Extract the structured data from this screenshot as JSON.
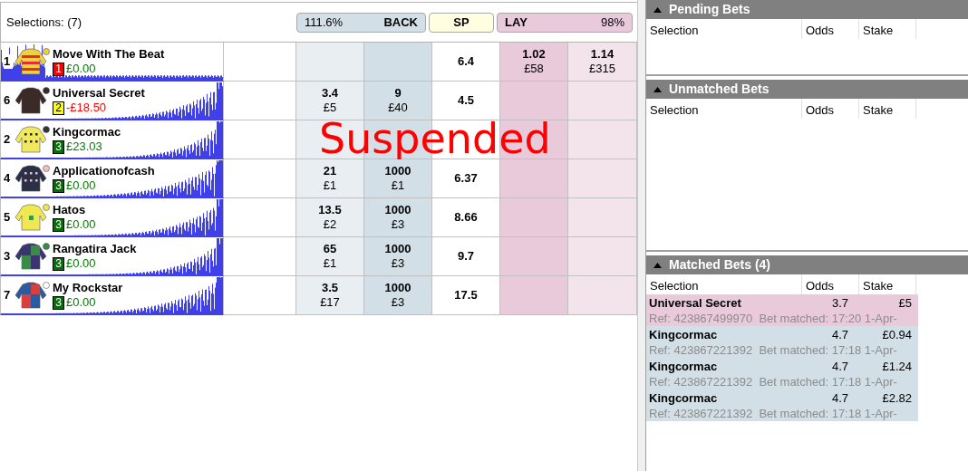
{
  "market": {
    "selections_label": "Selections: (7)",
    "back_header": {
      "percent": "111.6%",
      "label": "BACK"
    },
    "sp_header": {
      "label": "SP"
    },
    "lay_header": {
      "label": "LAY",
      "percent": "98%"
    },
    "overlay_text": "Suspended"
  },
  "runners": [
    {
      "number": "1",
      "name": "Move With The Beat",
      "rank": "1",
      "color": "#ff0000",
      "pnl": "£0.00",
      "pnl_negative": false,
      "sp": "6.4",
      "lay": [
        {
          "odds": "1.02",
          "amount": "£58"
        },
        {
          "odds": "1.14",
          "amount": "£315"
        }
      ]
    },
    {
      "number": "6",
      "name": "Universal Secret",
      "rank": "2",
      "color": "#ffff00",
      "pnl": "-£18.50",
      "pnl_negative": true,
      "back": [
        {
          "odds": "3.4",
          "amount": "£5"
        },
        {
          "odds": "9",
          "amount": "£40"
        }
      ],
      "sp": "4.5"
    },
    {
      "number": "2",
      "name": "Kingcormac",
      "rank": "3",
      "color": "#007000",
      "pnl": "£23.03",
      "pnl_negative": false,
      "suspended": true
    },
    {
      "number": "4",
      "name": "Applicationofcash",
      "rank": "3",
      "color": "#007000",
      "pnl": "£0.00",
      "pnl_negative": false,
      "back": [
        {
          "odds": "21",
          "amount": "£1"
        },
        {
          "odds": "1000",
          "amount": "£1"
        }
      ],
      "sp": "6.37"
    },
    {
      "number": "5",
      "name": "Hatos",
      "rank": "3",
      "color": "#007000",
      "pnl": "£0.00",
      "pnl_negative": false,
      "back": [
        {
          "odds": "13.5",
          "amount": "£2"
        },
        {
          "odds": "1000",
          "amount": "£3"
        }
      ],
      "sp": "8.66"
    },
    {
      "number": "3",
      "name": "Rangatira Jack",
      "rank": "3",
      "color": "#007000",
      "pnl": "£0.00",
      "pnl_negative": false,
      "back": [
        {
          "odds": "65",
          "amount": "£1"
        },
        {
          "odds": "1000",
          "amount": "£3"
        }
      ],
      "sp": "9.7"
    },
    {
      "number": "7",
      "name": "My Rockstar",
      "rank": "3",
      "color": "#007000",
      "pnl": "£0.00",
      "pnl_negative": false,
      "back": [
        {
          "odds": "3.5",
          "amount": "£17"
        },
        {
          "odds": "1000",
          "amount": "£3"
        }
      ],
      "sp": "17.5"
    }
  ],
  "bet_panels": [
    {
      "title": "Pending Bets",
      "columns": [
        "Selection",
        "Odds",
        "Stake"
      ]
    },
    {
      "title": "Unmatched Bets",
      "columns": [
        "Selection",
        "Odds",
        "Stake"
      ]
    },
    {
      "title": "Matched Bets (4)",
      "columns": [
        "Selection",
        "Odds",
        "Stake"
      ],
      "bets": [
        {
          "kind": "lay",
          "selection": "Universal Secret",
          "odds": "3.7",
          "stake": "£5",
          "ref": "Ref: 423867499970  Bet matched: 17:20 1-Apr-"
        },
        {
          "kind": "back",
          "selection": "Kingcormac",
          "odds": "4.7",
          "stake": "£0.94",
          "ref": "Ref: 423867221392  Bet matched: 17:18 1-Apr-"
        },
        {
          "kind": "back",
          "selection": "Kingcormac",
          "odds": "4.7",
          "stake": "£1.24",
          "ref": "Ref: 423867221392  Bet matched: 17:18 1-Apr-"
        },
        {
          "kind": "back",
          "selection": "Kingcormac",
          "odds": "4.7",
          "stake": "£2.82",
          "ref": "Ref: 423867221392  Bet matched: 17:18 1-Apr-"
        }
      ]
    }
  ]
}
